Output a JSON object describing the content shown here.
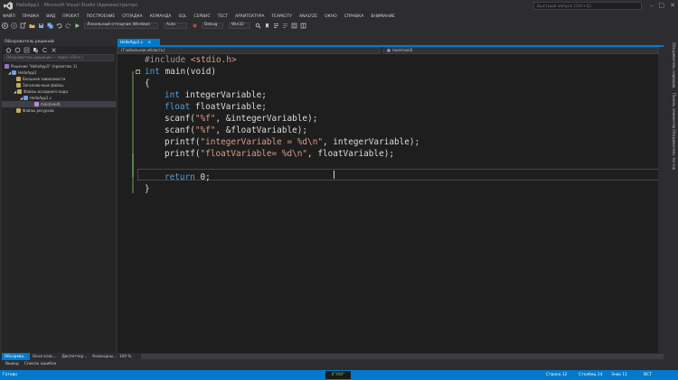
{
  "window": {
    "title": "HelloApp1 - Microsoft Visual Studio (Администратор)",
    "quick_launch_placeholder": "Быстрый запуск (Ctrl+Q)",
    "buttons": [
      "–",
      "□",
      "✕"
    ]
  },
  "menu": [
    "ФАЙЛ",
    "ПРАВКА",
    "ВИД",
    "ПРОЕКТ",
    "ПОСТРОЕНИЕ",
    "ОТЛАДКА",
    "КОМАНДА",
    "SQL",
    "СЕРВИС",
    "ТЕСТ",
    "АРХИТЕКТУРА",
    "TEAMCITY",
    "ANALYZE",
    "ОКНО",
    "СПРАВКА",
    "ВНИМАНИЕ"
  ],
  "toolbar": {
    "run_label": "Локальный отладчик Windows",
    "mode": "Auto",
    "config": "Debug",
    "platform": "Win32"
  },
  "solution_explorer": {
    "title": "Обозреватель решений",
    "search_placeholder": "Обозреватель решений — поиск (Ctrl+;)",
    "items": [
      {
        "label": "Решение \"HelloApp1\" (проектов: 1)"
      },
      {
        "label": "HelloApp1"
      },
      {
        "label": "Внешние зависимости"
      },
      {
        "label": "Заголовочные файлы"
      },
      {
        "label": "Файлы исходного кода"
      },
      {
        "label": "HelloApp1.c"
      },
      {
        "label": "main(void)"
      },
      {
        "label": "Файлы ресурсов"
      }
    ]
  },
  "left_tabs": [
    "Обозрева...",
    "Окно клас...",
    "Диспетчер...",
    "Командны..."
  ],
  "editor": {
    "tab_label": "HelloApp1.c",
    "nav_scope": "(Глобальная область)",
    "nav_member": "main(void)",
    "zoom": "100 %",
    "lines": [
      [
        "pp",
        "#include "
      ],
      [
        "str",
        "<stdio.h>"
      ],
      [
        "kw",
        "int"
      ],
      [
        "plain",
        " main(void)"
      ],
      [
        "plain",
        "{"
      ],
      [
        "kw",
        "int"
      ],
      [
        "plain",
        " integerVariable;"
      ],
      [
        "kw",
        "float"
      ],
      [
        "plain",
        " floatVariable;"
      ],
      [
        "plain",
        "scanf("
      ],
      [
        "str",
        "\"%f\""
      ],
      [
        "plain",
        ", &integerVariable);"
      ],
      [
        "plain",
        "scanf("
      ],
      [
        "str",
        "\"%f\""
      ],
      [
        "plain",
        ", &floatVariable);"
      ],
      [
        "plain",
        "printf("
      ],
      [
        "str",
        "\"integerVariable = %d\\n\""
      ],
      [
        "plain",
        ", integerVariable);"
      ],
      [
        "plain",
        "printf("
      ],
      [
        "str",
        "\"floatVariable= %d\\n\""
      ],
      [
        "plain",
        ", floatVariable);"
      ],
      [
        "kw",
        "return"
      ],
      [
        "plain",
        " 0;"
      ],
      [
        "plain",
        "}"
      ]
    ]
  },
  "right_tabs": [
    "Обозреватель серверов",
    "Панель элементов",
    "Обозреватель тестов"
  ],
  "output_tabs": [
    "Вывод",
    "Список ошибок"
  ],
  "status": {
    "left": "Готово",
    "center": "4°/00°",
    "line": "Строка 12",
    "col": "Столбец 14",
    "ch": "Знак 11",
    "mode": "ВСТ"
  },
  "colors": {
    "accent": "#007acc",
    "keyword": "#569cd6",
    "string": "#d69d85",
    "preprocessor": "#9b9b9b"
  }
}
